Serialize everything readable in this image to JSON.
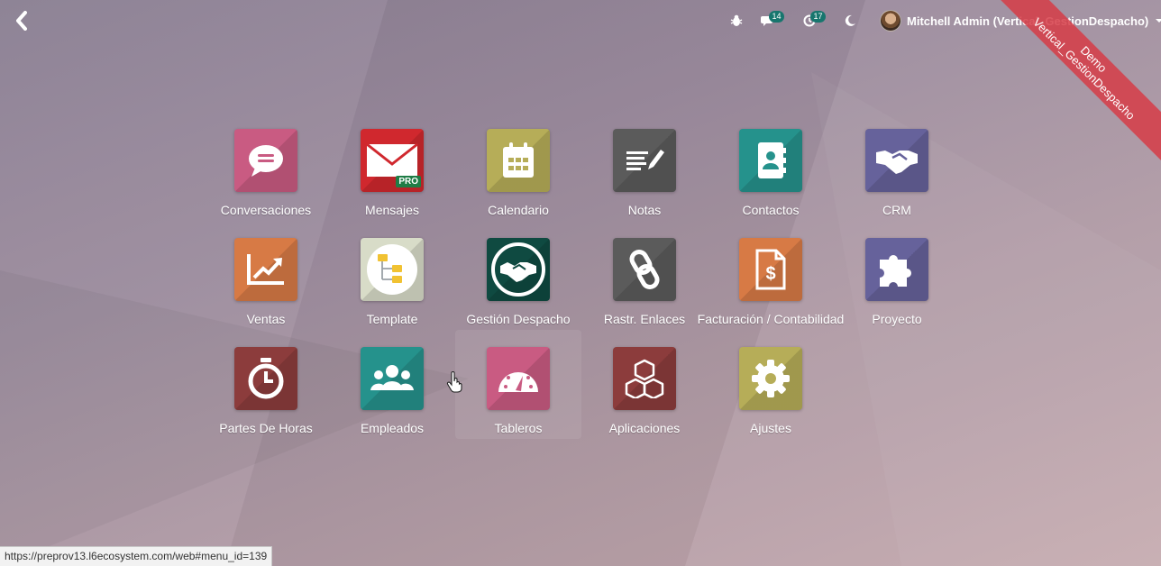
{
  "topbar": {
    "badges": {
      "messages": "14",
      "activities": "17"
    },
    "user": {
      "name": "Mitchell Admin (Vertical_GestionDespacho)"
    },
    "ribbon": {
      "line1": "Demo",
      "line2": "Vertical_GestionDespacho"
    }
  },
  "apps": [
    {
      "label": "Conversaciones",
      "color": "#c95b82",
      "icon": "chat-bubble-icon"
    },
    {
      "label": "Mensajes",
      "color": "#d0282e",
      "icon": "envelope-icon",
      "badge": "PRO"
    },
    {
      "label": "Calendario",
      "color": "#b6ad58",
      "icon": "calendar-icon"
    },
    {
      "label": "Notas",
      "color": "#5b5b5b",
      "icon": "notes-icon"
    },
    {
      "label": "Contactos",
      "color": "#25928c",
      "icon": "address-book-icon"
    },
    {
      "label": "CRM",
      "color": "#66629b",
      "icon": "handshake-icon"
    },
    {
      "label": "Ventas",
      "color": "#d77a45",
      "icon": "trend-chart-icon"
    },
    {
      "label": "Template",
      "color": "#d8dcc8",
      "icon": "folder-tree-icon"
    },
    {
      "label": "Gestión Despacho",
      "color": "#0f4a41",
      "icon": "handshake-circle-icon"
    },
    {
      "label": "Rastr. Enlaces",
      "color": "#5b5b5b",
      "icon": "link-icon"
    },
    {
      "label": "Facturación / Contabilidad",
      "color": "#d77a45",
      "icon": "invoice-icon"
    },
    {
      "label": "Proyecto",
      "color": "#66629b",
      "icon": "puzzle-icon"
    },
    {
      "label": "Partes De Horas",
      "color": "#8c3c3c",
      "icon": "stopwatch-icon"
    },
    {
      "label": "Empleados",
      "color": "#25928c",
      "icon": "users-icon"
    },
    {
      "label": "Tableros",
      "color": "#c95b82",
      "icon": "gauge-icon"
    },
    {
      "label": "Aplicaciones",
      "color": "#8c3c3c",
      "icon": "cubes-icon"
    },
    {
      "label": "Ajustes",
      "color": "#b6ad58",
      "icon": "gear-icon"
    }
  ],
  "status_bar": {
    "url": "https://preprov13.l6ecosystem.com/web#menu_id=139"
  }
}
